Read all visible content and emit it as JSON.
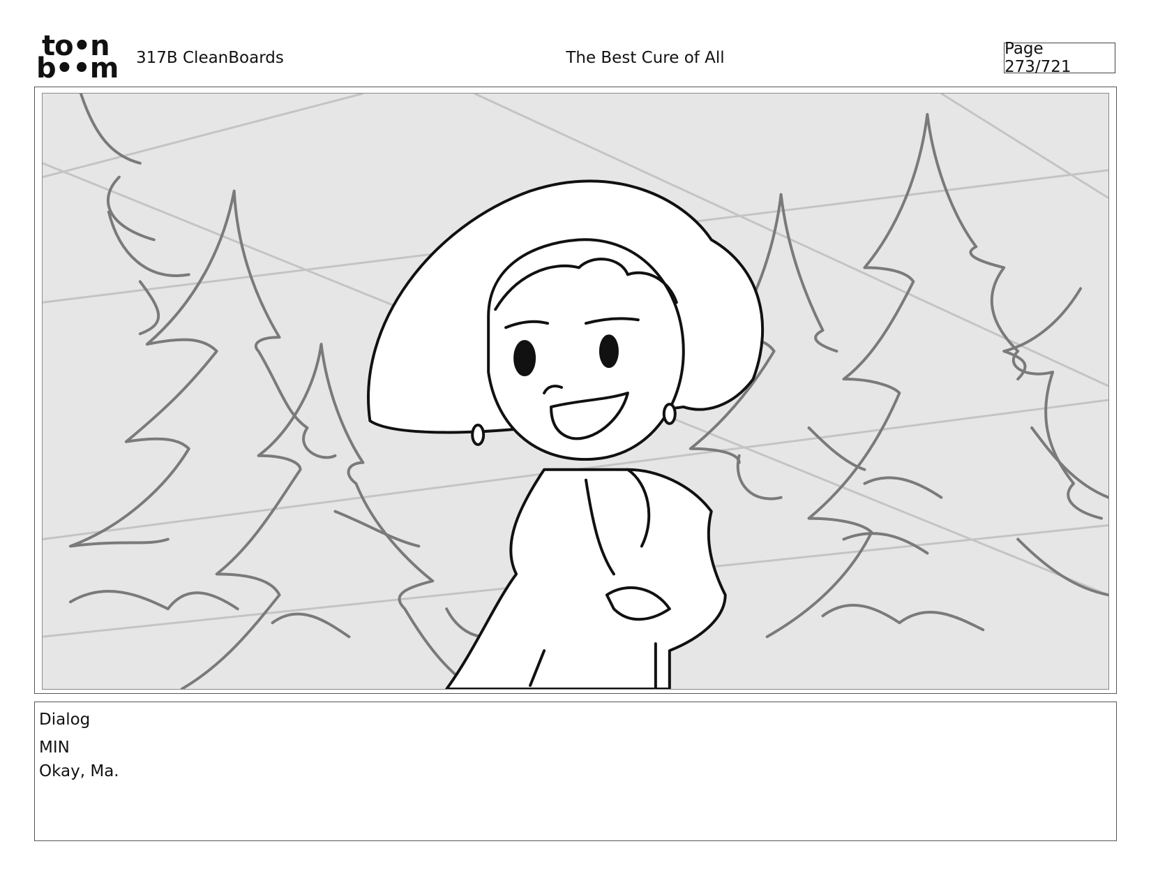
{
  "header": {
    "logo_line1": "to•n",
    "logo_line2": "b••m",
    "project": "317B  CleanBoards",
    "title": "The Best Cure of All",
    "page": "Page 273/721"
  },
  "dialog": {
    "label": "Dialog",
    "character": "MIN",
    "line": "Okay, Ma."
  },
  "colors": {
    "panel_background": "#e6e6e6",
    "tree_stroke": "#7a7a7a",
    "character_stroke": "#111111"
  }
}
